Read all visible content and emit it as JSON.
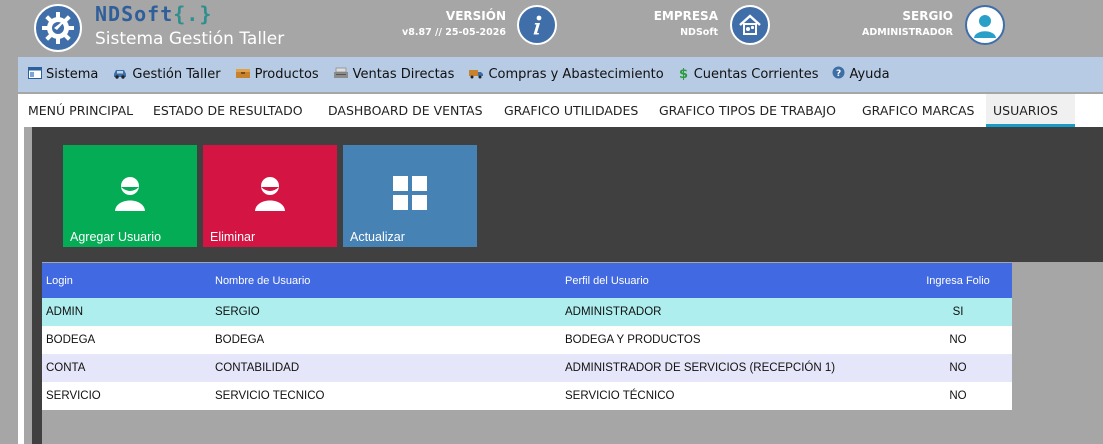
{
  "header": {
    "brand_name": "NDSoft",
    "brand_braces": "{.}",
    "subtitle": "Sistema Gestión Taller",
    "version_label": "VERSIÓN",
    "version_value": "v8.87 // 25-05-2026",
    "company_label": "EMPRESA",
    "company_value": "NDSoft",
    "user_name": "SERGIO",
    "user_role": "ADMINISTRADOR"
  },
  "menubar": {
    "items": [
      {
        "label": "Sistema",
        "icon": "window-icon"
      },
      {
        "label": "Gestión Taller",
        "icon": "car-icon"
      },
      {
        "label": "Productos",
        "icon": "box-icon"
      },
      {
        "label": "Ventas Directas",
        "icon": "register-icon"
      },
      {
        "label": "Compras y Abastecimiento",
        "icon": "truck-icon"
      },
      {
        "label": "Cuentas Corrientes",
        "icon": "dollar-icon"
      },
      {
        "label": "Ayuda",
        "icon": "help-icon"
      }
    ]
  },
  "tabs": [
    {
      "label": "MENÚ PRINCIPAL"
    },
    {
      "label": "ESTADO DE RESULTADO"
    },
    {
      "label": "DASHBOARD DE VENTAS"
    },
    {
      "label": "GRAFICO UTILIDADES"
    },
    {
      "label": "GRAFICO TIPOS DE TRABAJO"
    },
    {
      "label": "GRAFICO MARCAS"
    },
    {
      "label": "USUARIOS"
    }
  ],
  "actions": {
    "add_label": "Agregar Usuario",
    "delete_label": "Eliminar",
    "refresh_label": "Actualizar"
  },
  "colors": {
    "add": "#04ad55",
    "delete": "#d41544",
    "refresh": "#4682b4",
    "grid_header": "#4169e1",
    "row_selected": "#afeeee",
    "row_alt": "#e6e6fa"
  },
  "grid": {
    "columns": [
      "Login",
      "Nombre de Usuario",
      "Perfil del Usuario",
      "Ingresa Folio"
    ],
    "rows": [
      [
        "ADMIN",
        "SERGIO",
        "ADMINISTRADOR",
        "SI"
      ],
      [
        "BODEGA",
        "BODEGA",
        "BODEGA Y PRODUCTOS",
        "NO"
      ],
      [
        "CONTA",
        "CONTABILIDAD",
        "ADMINISTRADOR DE SERVICIOS (RECEPCIÓN 1)",
        "NO"
      ],
      [
        "SERVICIO",
        "SERVICIO TECNICO",
        "SERVICIO TÉCNICO",
        "NO"
      ]
    ]
  }
}
